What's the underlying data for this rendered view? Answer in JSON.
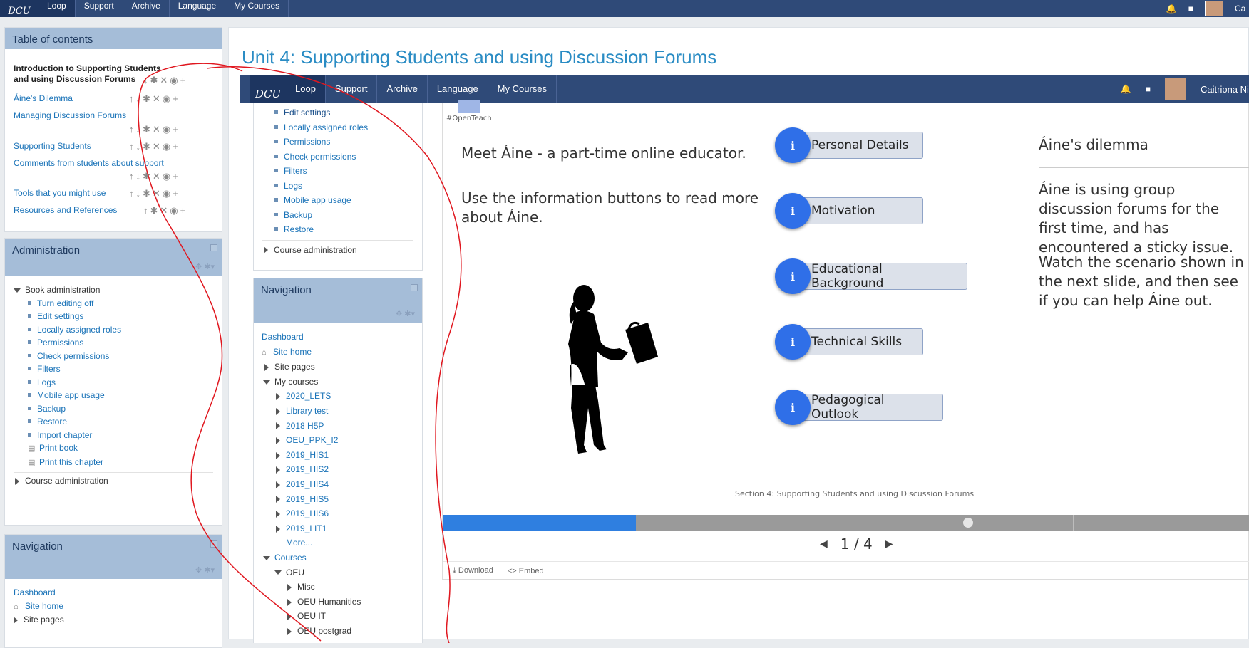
{
  "topbar": {
    "logo": "DCU",
    "items": [
      "Loop",
      "Support",
      "Archive",
      "Language",
      "My Courses"
    ],
    "user": "Ca"
  },
  "toc": {
    "title": "Table of contents",
    "items": [
      "Introduction to Supporting Students and using Discussion Forums",
      "Áine's Dilemma",
      "Managing Discussion Forums",
      "Supporting Students",
      "Comments from students about support",
      "Tools that you might use",
      "Resources and References"
    ]
  },
  "admin": {
    "title": "Administration",
    "book_admin": "Book administration",
    "items": [
      "Turn editing off",
      "Edit settings",
      "Locally assigned roles",
      "Permissions",
      "Check permissions",
      "Filters",
      "Logs",
      "Mobile app usage",
      "Backup",
      "Restore",
      "Import chapter"
    ],
    "print_book": "Print book",
    "print_chapter": "Print this chapter",
    "course_admin": "Course administration"
  },
  "nav_left": {
    "title": "Navigation",
    "dashboard": "Dashboard",
    "site_home": "Site home",
    "site_pages": "Site pages"
  },
  "main": {
    "title": "Unit 4: Supporting Students and using Discussion Forums"
  },
  "inner": {
    "logo": "DCU",
    "items": [
      "Loop",
      "Support",
      "Archive",
      "Language",
      "My Courses"
    ],
    "user": "Caitriona Ni",
    "admin_items": [
      "Edit settings",
      "Locally assigned roles",
      "Permissions",
      "Check permissions",
      "Filters",
      "Logs",
      "Mobile app usage",
      "Backup",
      "Restore"
    ],
    "course_admin": "Course administration",
    "nav_title": "Navigation",
    "nav": {
      "dashboard": "Dashboard",
      "site_home": "Site home",
      "site_pages": "Site pages",
      "my_courses": "My courses",
      "courses_list": [
        "2020_LETS",
        "Library test",
        "2018 H5P",
        "OEU_PPK_I2",
        "2019_HIS1",
        "2019_HIS2",
        "2019_HIS4",
        "2019_HIS5",
        "2019_HIS6",
        "2019_LIT1"
      ],
      "more": "More...",
      "courses": "Courses",
      "oeu": "OEU",
      "oeu_sub": [
        "Misc",
        "OEU Humanities",
        "OEU IT",
        "OEU postgrad"
      ]
    }
  },
  "h5p": {
    "logo_text": "#OpenTeach",
    "heading": "Meet Áine - a part-time online educator.",
    "body": "Use the information buttons to read more about Áine.",
    "buttons": [
      "Personal Details",
      "Motivation",
      "Educational Background",
      "Technical Skills",
      "Pedagogical Outlook"
    ],
    "side_title": "Áine's dilemma",
    "side_p1": "Áine is using group discussion forums for the first time, and has encountered a sticky issue.",
    "side_p2": "Watch the scenario shown in the next slide, and then see if you can help Áine out.",
    "caption": "Section 4: Supporting Students and using Discussion Forums",
    "progress": 0.24,
    "pager": "1 / 4",
    "download": "Download",
    "embed": "Embed",
    "accent": "#2f6fe8"
  }
}
